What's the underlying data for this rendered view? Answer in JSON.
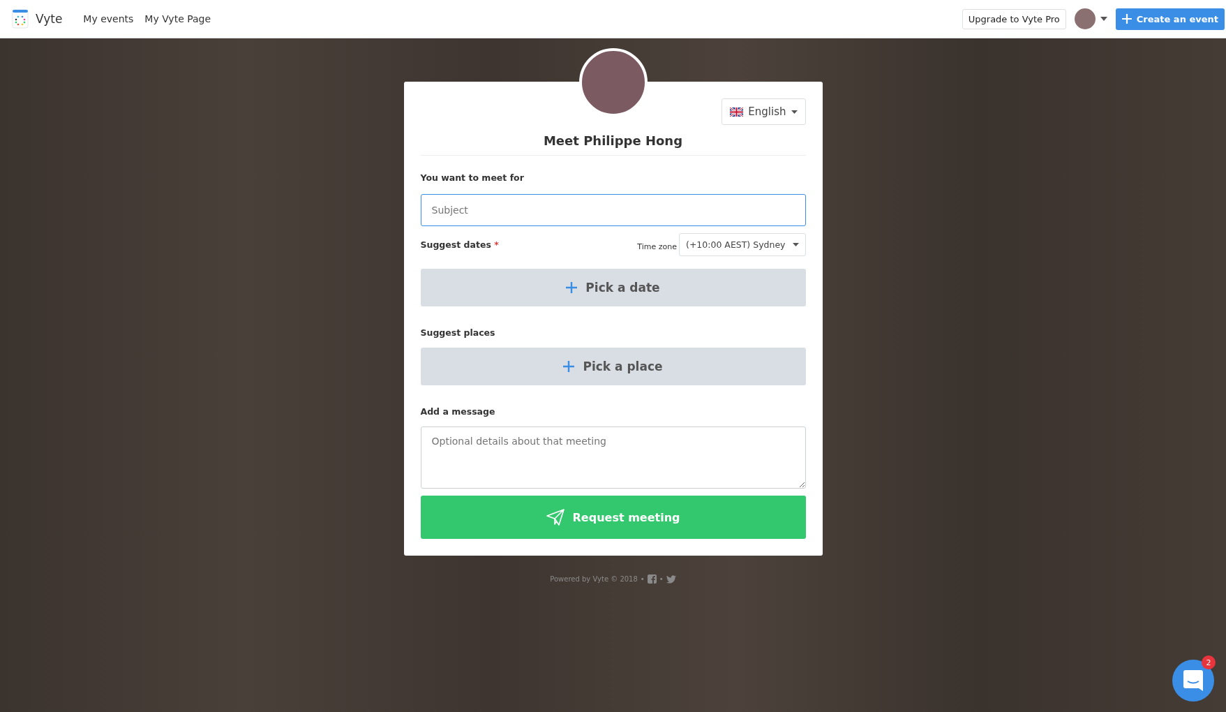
{
  "navbar": {
    "brand": "Vyte",
    "links": [
      "My events",
      "My Vyte Page"
    ],
    "upgrade_button": "Upgrade to Vyte Pro",
    "create_button": "Create an event"
  },
  "card": {
    "language": "English",
    "title": "Meet Philippe Hong",
    "subject": {
      "label": "You want to meet for",
      "placeholder": "Subject"
    },
    "dates": {
      "label": "Suggest dates",
      "required_mark": "*",
      "timezone_label": "Time zone",
      "timezone": "(+10:00 AEST) Sydney",
      "button": "Pick a date"
    },
    "places": {
      "label": "Suggest places",
      "button": "Pick a place"
    },
    "message": {
      "label": "Add a message",
      "placeholder": "Optional details about that meeting"
    },
    "submit": "Request meeting"
  },
  "footer": {
    "text": "Powered by Vyte © 2018",
    "separators": [
      "•",
      "•"
    ]
  },
  "chat": {
    "badge": "2"
  }
}
